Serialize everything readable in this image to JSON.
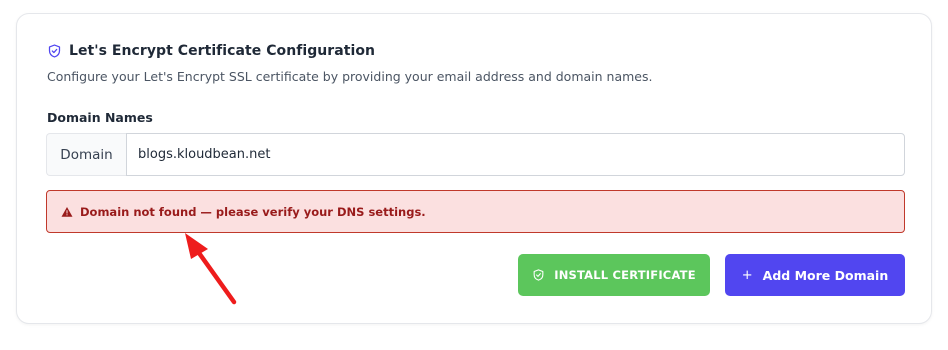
{
  "card": {
    "title": "Let's Encrypt Certificate Configuration",
    "title_icon": "shield-check-icon",
    "subtitle": "Configure your Let's Encrypt SSL certificate by providing your email address and domain names."
  },
  "domain_field": {
    "label": "Domain Names",
    "addon": "Domain",
    "value": "blogs.kloudbean.net",
    "placeholder": ""
  },
  "alert": {
    "icon": "warning-triangle-icon",
    "message": "Domain not found — please verify your DNS settings.",
    "color": "#991b1b",
    "background": "#fbe0e0"
  },
  "buttons": {
    "install": {
      "label": "INSTALL CERTIFICATE",
      "icon": "shield-check-icon",
      "color": "#5cc65c"
    },
    "add_domain": {
      "label": "Add More Domain",
      "icon": "plus-icon",
      "plus": "+",
      "color": "#5146f0"
    }
  },
  "annotation": {
    "icon": "red-arrow-icon",
    "color": "#ee1c1c"
  }
}
